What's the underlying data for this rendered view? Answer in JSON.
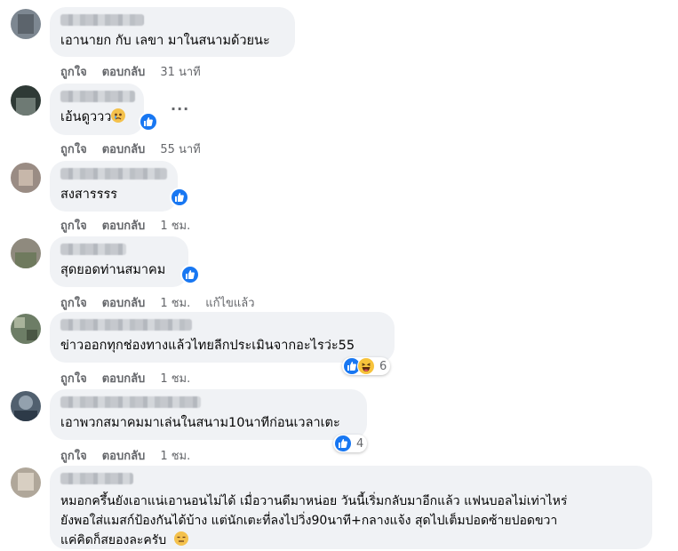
{
  "actions": {
    "like": "ถูกใจ",
    "reply": "ตอบกลับ"
  },
  "comments": [
    {
      "text": "เอานายก กับ เลขา มาในสนามด้วยนะ",
      "time": "31 นาที"
    },
    {
      "text": "เอ้นดูววว",
      "emoji": "sad-face",
      "time": "55 นาที"
    },
    {
      "text": "สงสารรรร",
      "time": "1 ชม."
    },
    {
      "text": "สุดยอดท่านสมาคม",
      "time": "1 ชม.",
      "edited": "แก้ไขแล้ว"
    },
    {
      "text": "ข่าวออกทุกช่องทางแล้วไทยลีกประเมินจากอะไรว่ะ55",
      "time": "1 ชม.",
      "reaction_count": "6"
    },
    {
      "text": "เอาพวกสมาคมมาเล่นในสนาม10นาทีก่อนเวลาเตะ",
      "time": "1 ชม.",
      "reaction_count": "4"
    },
    {
      "lines": [
        "หมอกครึ้นยังเอาแน่เอานอนไม่ได้ เมื่อวานดีมาหน่อย วันนี้เริ่มกลับมาอีกแล้ว แฟนบอลไม่เท่าไหร่",
        "ยังพอใส่แมสก์ป้องกันได้บ้าง แต่นักเตะที่ลงไปวิ่ง90นาที+กลางแจ้ง สุดไปเต็มปอดซ้ายปอดขวา",
        "แค่คิดก็สยองละครับ"
      ],
      "emoji": "expressionless-face"
    }
  ],
  "more_options": "···",
  "colors": {
    "bubble": "#f0f2f5",
    "meta": "#65676b",
    "like_blue": "#1877f2"
  }
}
